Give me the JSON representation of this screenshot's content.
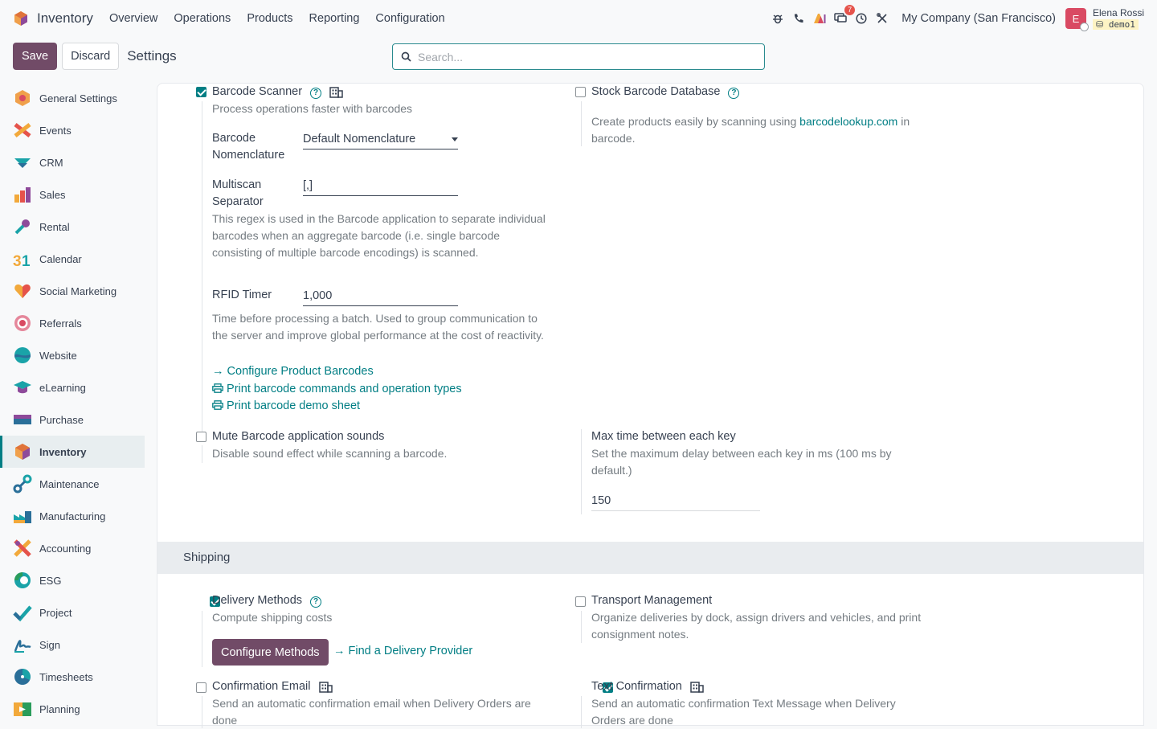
{
  "navbar": {
    "app_name": "Inventory",
    "menu": [
      "Overview",
      "Operations",
      "Products",
      "Reporting",
      "Configuration"
    ],
    "messages_badge": "7",
    "company": "My Company (San Francisco)",
    "avatar_letter": "E",
    "user_name": "Elena Rossi",
    "user_db": "demo1"
  },
  "control": {
    "save_label": "Save",
    "discard_label": "Discard",
    "page_title": "Settings",
    "search_placeholder": "Search..."
  },
  "sidebar": {
    "items": [
      {
        "label": "General Settings",
        "icon": "general-settings-icon"
      },
      {
        "label": "Events",
        "icon": "events-icon"
      },
      {
        "label": "CRM",
        "icon": "crm-icon"
      },
      {
        "label": "Sales",
        "icon": "sales-icon"
      },
      {
        "label": "Rental",
        "icon": "rental-icon"
      },
      {
        "label": "Calendar",
        "icon": "calendar-icon"
      },
      {
        "label": "Social Marketing",
        "icon": "social-marketing-icon"
      },
      {
        "label": "Referrals",
        "icon": "referrals-icon"
      },
      {
        "label": "Website",
        "icon": "website-icon"
      },
      {
        "label": "eLearning",
        "icon": "elearning-icon"
      },
      {
        "label": "Purchase",
        "icon": "purchase-icon"
      },
      {
        "label": "Inventory",
        "icon": "inventory-icon",
        "active": true
      },
      {
        "label": "Maintenance",
        "icon": "maintenance-icon"
      },
      {
        "label": "Manufacturing",
        "icon": "manufacturing-icon"
      },
      {
        "label": "Accounting",
        "icon": "accounting-icon"
      },
      {
        "label": "ESG",
        "icon": "esg-icon"
      },
      {
        "label": "Project",
        "icon": "project-icon"
      },
      {
        "label": "Sign",
        "icon": "sign-icon"
      },
      {
        "label": "Timesheets",
        "icon": "timesheets-icon"
      },
      {
        "label": "Planning",
        "icon": "planning-icon"
      }
    ]
  },
  "barcode": {
    "scanner_title": "Barcode Scanner",
    "scanner_checked": true,
    "scanner_desc": "Process operations faster with barcodes",
    "nomenclature_label_1": "Barcode",
    "nomenclature_label_2": "Nomenclature",
    "nomenclature_value": "Default Nomenclature",
    "multiscan_label_1": "Multiscan",
    "multiscan_label_2": "Separator",
    "multiscan_value": "[,]",
    "multiscan_help_1": "This regex is used in the Barcode application to separate individual",
    "multiscan_help_2": "barcodes when an aggregate barcode (i.e. single barcode",
    "multiscan_help_3": "consisting of multiple barcode encodings) is scanned.",
    "rfid_label": "RFID Timer",
    "rfid_value": "1,000",
    "rfid_help_1": "Time before processing a batch. Used to group communication to",
    "rfid_help_2": "the server and improve global performance at the cost of reactivity.",
    "link_configure": "Configure Product Barcodes",
    "link_print_commands": "Print barcode commands and operation types",
    "link_print_demo": "Print barcode demo sheet",
    "stock_db_title": "Stock Barcode Database",
    "stock_db_checked": false,
    "stock_db_desc_pre": "Create products easily by scanning using ",
    "stock_db_desc_link": "barcodelookup.com",
    "stock_db_desc_post": " in",
    "stock_db_desc_2": "barcode.",
    "mute_title": "Mute Barcode application sounds",
    "mute_checked": false,
    "mute_desc": "Disable sound effect while scanning a barcode.",
    "maxtime_title": "Max time between each key",
    "maxtime_desc_1": "Set the maximum delay between each key in ms (100 ms by",
    "maxtime_desc_2": "default.)",
    "maxtime_value": "150"
  },
  "shipping": {
    "section_title": "Shipping",
    "delivery_title": "Delivery Methods",
    "delivery_checked": true,
    "delivery_desc": "Compute shipping costs",
    "configure_methods": "Configure Methods",
    "find_provider": "Find a Delivery Provider",
    "transport_title": "Transport Management",
    "transport_checked": false,
    "transport_desc_1": "Organize deliveries by dock, assign drivers and vehicles, and print",
    "transport_desc_2": "consignment notes.",
    "confirm_email_title": "Confirmation Email",
    "confirm_email_checked": false,
    "confirm_email_desc_1": "Send an automatic confirmation email when Delivery Orders are",
    "confirm_email_desc_2": "done",
    "text_confirm_title": "Text Confirmation",
    "text_confirm_checked": true,
    "text_confirm_desc_1": "Send an automatic confirmation Text Message when Delivery",
    "text_confirm_desc_2": "Orders are done"
  }
}
